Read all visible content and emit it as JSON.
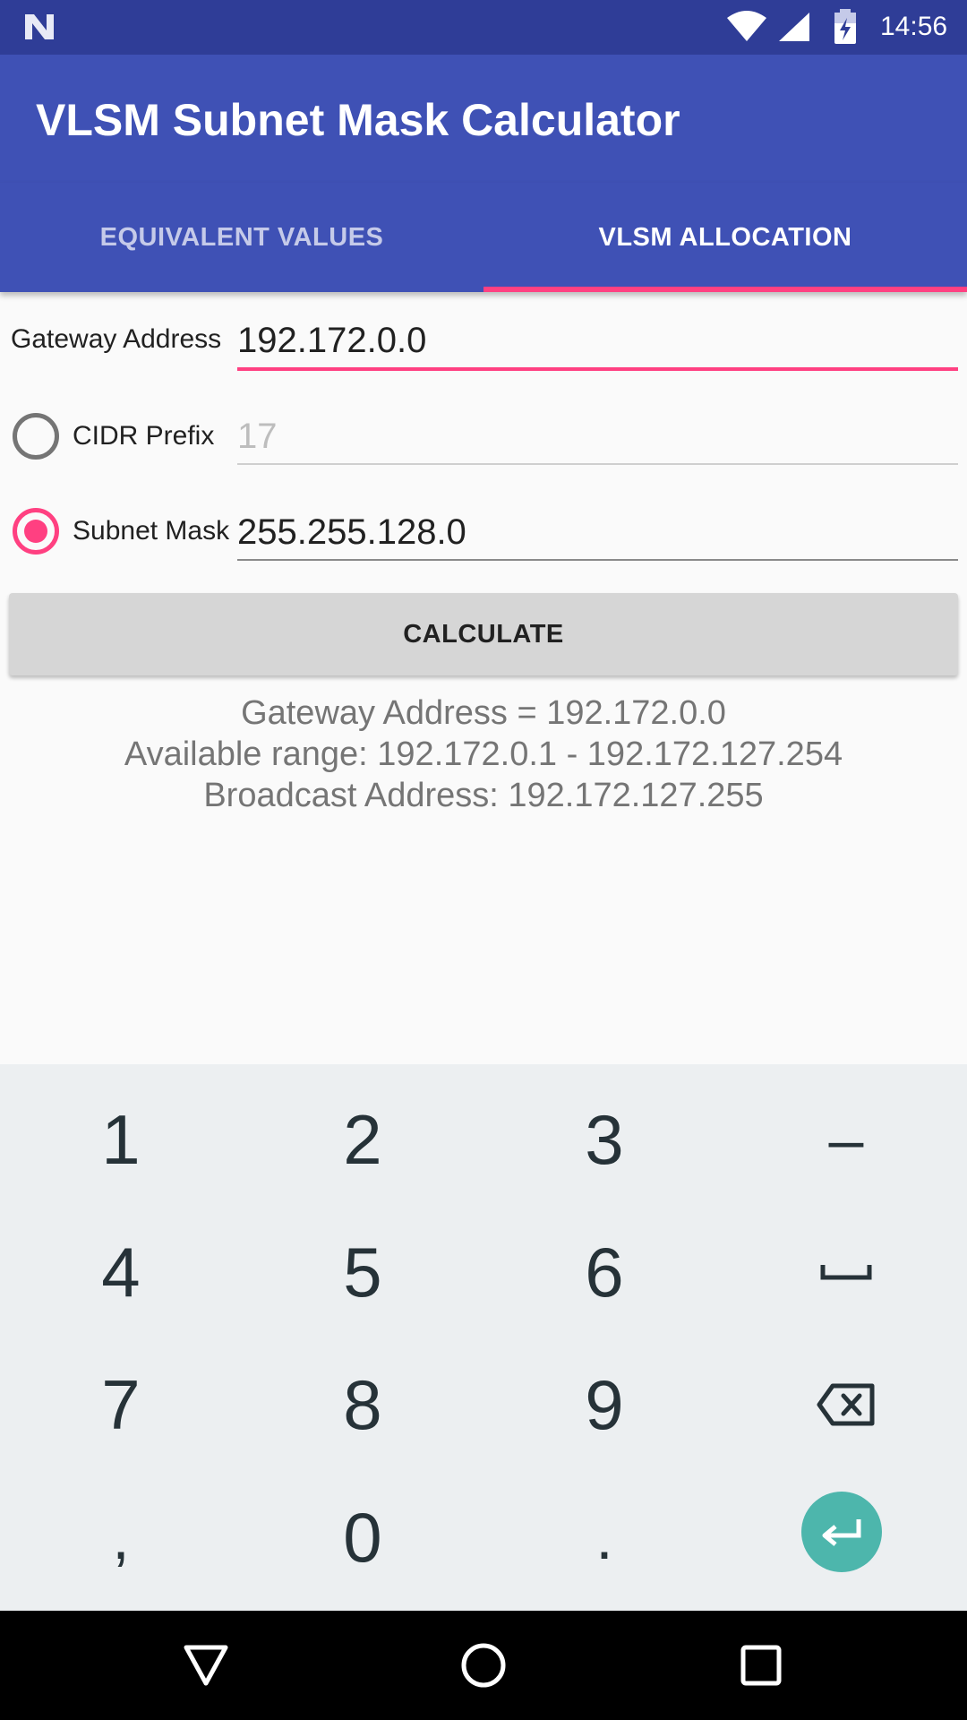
{
  "status_bar": {
    "time": "14:56",
    "icons": [
      "notification-n-icon",
      "wifi-icon",
      "signal-icon",
      "battery-charging-icon"
    ]
  },
  "app_bar": {
    "title": "VLSM Subnet Mask Calculator"
  },
  "tabs": [
    {
      "label": "EQUIVALENT VALUES",
      "selected": false
    },
    {
      "label": "VLSM ALLOCATION",
      "selected": true
    }
  ],
  "colors": {
    "primary": "#3f51b5",
    "primary_dark": "#2f3d97",
    "accent": "#ff4081",
    "enter_key": "#4db6ac"
  },
  "form": {
    "gateway": {
      "label": "Gateway Address",
      "value": "192.172.0.0"
    },
    "cidr": {
      "label": "CIDR Prefix",
      "placeholder": "17",
      "selected": false
    },
    "subnet": {
      "label": "Subnet Mask",
      "value": "255.255.128.0",
      "selected": true
    },
    "calculate_label": "CALCULATE"
  },
  "result": {
    "line1": "Gateway Address = 192.172.0.0",
    "line2": "Available range: 192.172.0.1 - 192.172.127.254",
    "line3": "Broadcast Address: 192.172.127.255"
  },
  "keyboard": {
    "keys": [
      [
        "1",
        "2",
        "3",
        "-"
      ],
      [
        "4",
        "5",
        "6",
        "space-icon"
      ],
      [
        "7",
        "8",
        "9",
        "backspace-icon"
      ],
      [
        ",",
        "0",
        ".",
        "enter-icon"
      ]
    ],
    "k1": "1",
    "k2": "2",
    "k3": "3",
    "k_dash": "–",
    "k4": "4",
    "k5": "5",
    "k6": "6",
    "k7": "7",
    "k8": "8",
    "k9": "9",
    "k_comma": ",",
    "k0": "0",
    "k_dot": "."
  },
  "nav_bar": {
    "icons": [
      "back-triangle-icon",
      "home-circle-icon",
      "recents-square-icon"
    ]
  }
}
